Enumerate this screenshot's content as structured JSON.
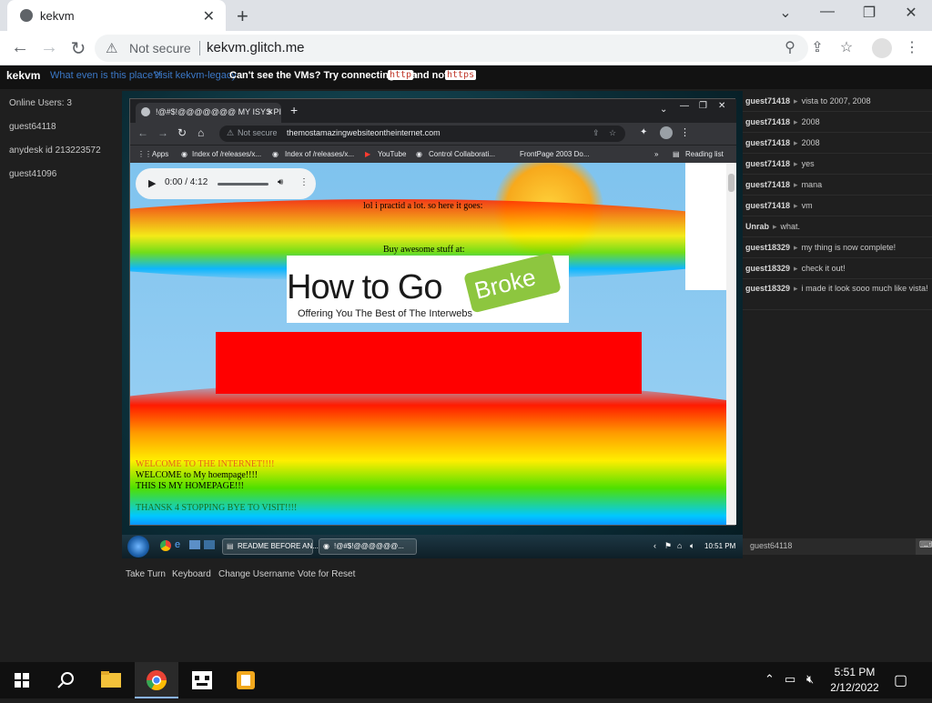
{
  "outer_browser": {
    "tab_title": "kekvm",
    "address_warning": "Not secure",
    "url": "kekvm.glitch.me"
  },
  "header": {
    "brand": "kekvm",
    "link1": "What even is this place?!",
    "link2": "Visit kekvm-legacy",
    "notice_prefix": "Can't see the VMs? Try connecting with",
    "code1": "http",
    "notice_mid": "and not",
    "code2": "https"
  },
  "users": {
    "count_label": "Online Users: 3",
    "list": [
      "guest64118",
      "anydesk id 213223572",
      "guest41096"
    ]
  },
  "vm": {
    "tab_title": "!@#$!@@@@@@@ MY ISYS PI",
    "omnibox_warning": "Not secure",
    "url": "themostamazingwebsiteontheinternet.com",
    "bookmarks": [
      "Apps",
      "Index of /releases/x...",
      "Index of /releases/x...",
      "YouTube",
      "Control Collaborati...",
      "FrontPage 2003 Do...",
      "Reading list"
    ],
    "audio_time": "0:00 / 4:12",
    "line1": "lol i practid a lot. so here it goes:",
    "line2": "Buy awesome stuff at:",
    "logo_main": "How to Go",
    "logo_tag": "Broke",
    "logo_sub": "Offering You The Best of The Interwebs",
    "welcome_lines": [
      "WELCOME TO THE INTERNET!!!!",
      "WELCOME to My hoempage!!!!",
      "THIS IS MY HOMEPAGE!!!",
      "THANSK 4 STOPPING BYE TO VISIT!!!!"
    ],
    "taskbar_items": [
      "README BEFORE AN...",
      "!@#$!@@@@@@..."
    ],
    "clock": "10:51 PM"
  },
  "chat": {
    "messages": [
      {
        "user": "guest71418",
        "text": "vista to 2007, 2008"
      },
      {
        "user": "guest71418",
        "text": "2008"
      },
      {
        "user": "guest71418",
        "text": "2008"
      },
      {
        "user": "guest71418",
        "text": "yes"
      },
      {
        "user": "guest71418",
        "text": "mana"
      },
      {
        "user": "guest71418",
        "text": "vm"
      },
      {
        "user": "Unrab",
        "text": "what."
      },
      {
        "user": "guest18329",
        "text": "my thing is now complete!"
      },
      {
        "user": "guest18329",
        "text": "check it out!"
      },
      {
        "user": "guest18329",
        "text": "i made it look sooo much like vista!"
      }
    ],
    "input_value": "guest64118"
  },
  "controls": [
    "Take Turn",
    "Keyboard",
    "Change Username",
    "Vote for Reset"
  ],
  "taskbar": {
    "time": "5:51 PM",
    "date": "2/12/2022"
  },
  "colors": {
    "accent_link": "#3b78c7",
    "red_box": "#ff0000",
    "welcome_orange": "#e8641a",
    "welcome_green": "#1a8f1a"
  }
}
